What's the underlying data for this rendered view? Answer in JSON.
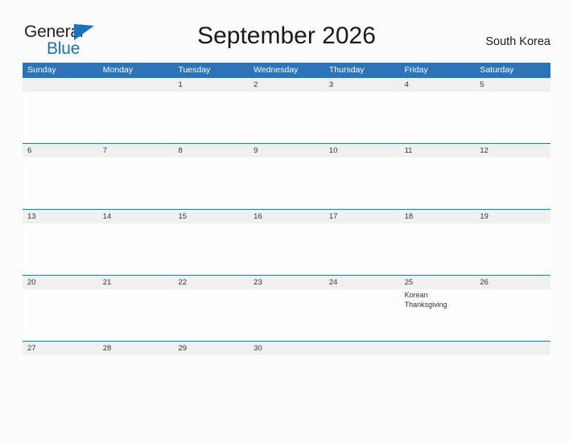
{
  "brand": {
    "name_part1": "General",
    "name_part2": "Blue",
    "mark_icon": "blue-flag-triangle-icon",
    "color_dark": "#231f20",
    "color_blue": "#1c72bb"
  },
  "header": {
    "title": "September 2026",
    "country": "South Korea"
  },
  "calendar": {
    "header_bg": "#2d73b5",
    "date_strip_bg": "#f0f0f0",
    "rule_color": "#2d73b5",
    "weekdays": [
      "Sunday",
      "Monday",
      "Tuesday",
      "Wednesday",
      "Thursday",
      "Friday",
      "Saturday"
    ],
    "weeks": [
      {
        "days": [
          {
            "date": "",
            "event": ""
          },
          {
            "date": "",
            "event": ""
          },
          {
            "date": "1",
            "event": ""
          },
          {
            "date": "2",
            "event": ""
          },
          {
            "date": "3",
            "event": ""
          },
          {
            "date": "4",
            "event": ""
          },
          {
            "date": "5",
            "event": ""
          }
        ]
      },
      {
        "days": [
          {
            "date": "6",
            "event": ""
          },
          {
            "date": "7",
            "event": ""
          },
          {
            "date": "8",
            "event": ""
          },
          {
            "date": "9",
            "event": ""
          },
          {
            "date": "10",
            "event": ""
          },
          {
            "date": "11",
            "event": ""
          },
          {
            "date": "12",
            "event": ""
          }
        ]
      },
      {
        "days": [
          {
            "date": "13",
            "event": ""
          },
          {
            "date": "14",
            "event": ""
          },
          {
            "date": "15",
            "event": ""
          },
          {
            "date": "16",
            "event": ""
          },
          {
            "date": "17",
            "event": ""
          },
          {
            "date": "18",
            "event": ""
          },
          {
            "date": "19",
            "event": ""
          }
        ]
      },
      {
        "days": [
          {
            "date": "20",
            "event": ""
          },
          {
            "date": "21",
            "event": ""
          },
          {
            "date": "22",
            "event": ""
          },
          {
            "date": "23",
            "event": ""
          },
          {
            "date": "24",
            "event": ""
          },
          {
            "date": "25",
            "event": "Korean Thanksgiving"
          },
          {
            "date": "26",
            "event": ""
          }
        ]
      },
      {
        "days": [
          {
            "date": "27",
            "event": ""
          },
          {
            "date": "28",
            "event": ""
          },
          {
            "date": "29",
            "event": ""
          },
          {
            "date": "30",
            "event": ""
          },
          {
            "date": "",
            "event": ""
          },
          {
            "date": "",
            "event": ""
          },
          {
            "date": "",
            "event": ""
          }
        ]
      }
    ]
  }
}
